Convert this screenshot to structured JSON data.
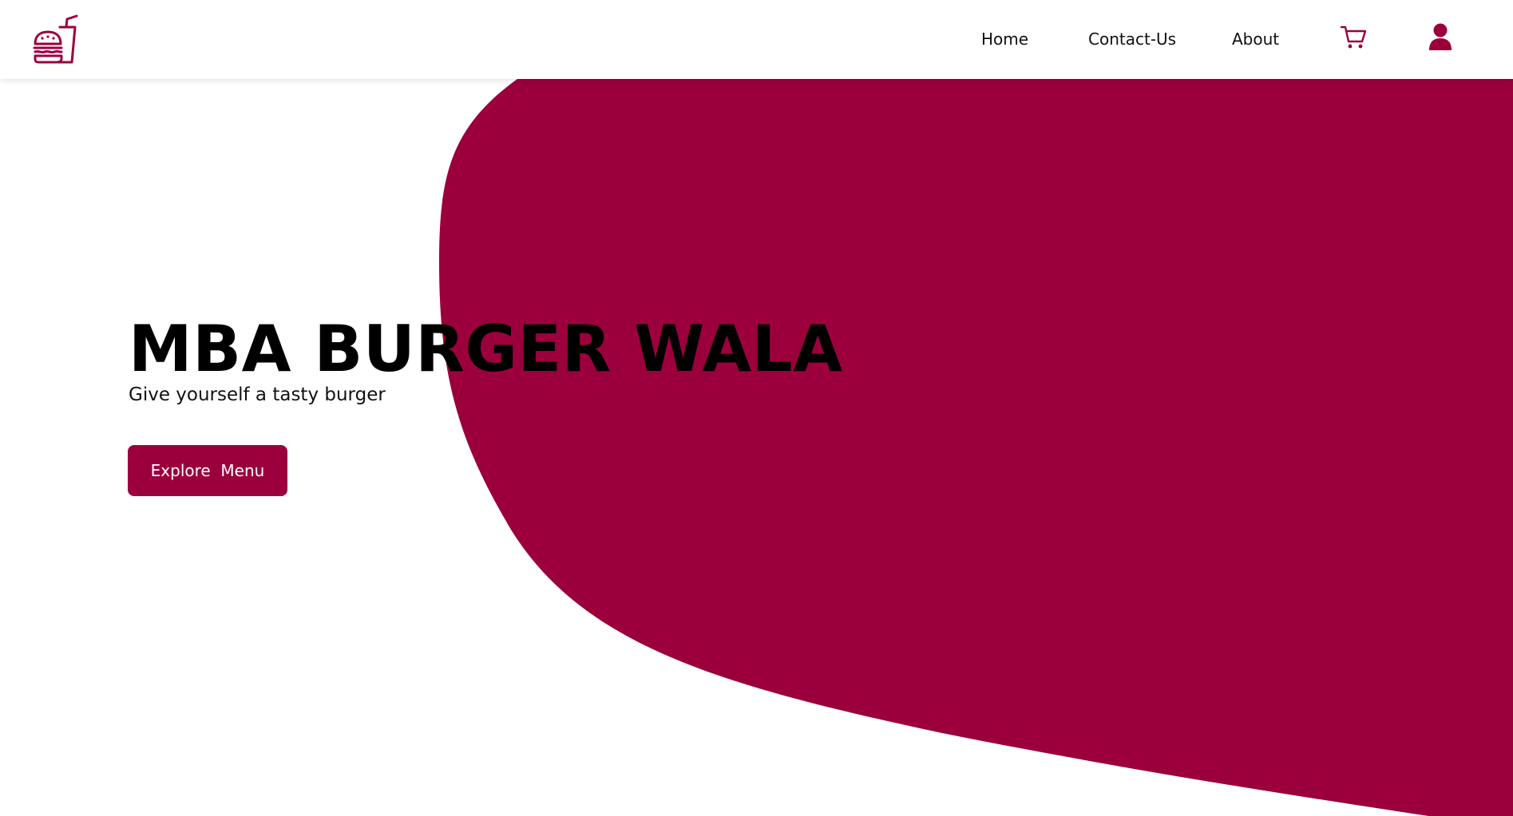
{
  "nav": {
    "links": {
      "home": "Home",
      "contact": "Contact-Us",
      "about": "About"
    },
    "icons": [
      "burger-drink-logo-icon",
      "cart-icon",
      "user-icon"
    ]
  },
  "hero": {
    "title": "MBA BURGER WALA",
    "subtitle": "Give yourself a tasty burger",
    "button_label": "Explore  Menu"
  },
  "colors": {
    "brand": "#9b003d",
    "wave_layers": [
      "#f2dce2",
      "#ebc6d0",
      "#e3b1c0",
      "#da9db1",
      "#d188a2",
      "#c97393",
      "#c05f84",
      "#b84b76",
      "#af3768",
      "#a6235a",
      "#9d0f4c",
      "#9b003d"
    ]
  }
}
